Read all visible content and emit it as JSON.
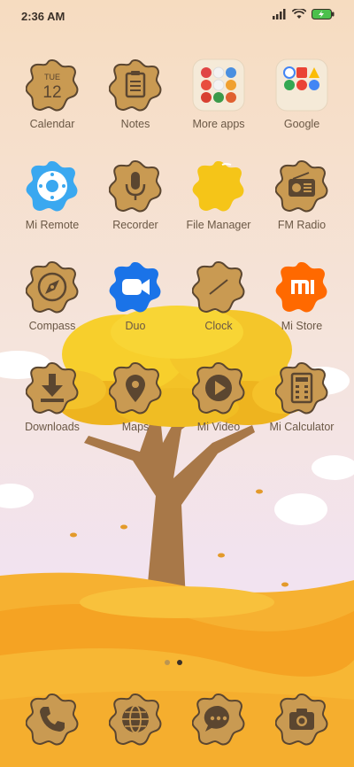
{
  "status_bar": {
    "time": "2:36 AM",
    "icons": [
      "signal-icon",
      "wifi-icon",
      "battery-charging-icon"
    ]
  },
  "calendar_badge": {
    "weekday": "TUE",
    "day": "12"
  },
  "apps": [
    {
      "label": "Calendar",
      "icon": "calendar-icon"
    },
    {
      "label": "Notes",
      "icon": "notes-icon"
    },
    {
      "label": "More apps",
      "icon": "folder-icon"
    },
    {
      "label": "Google",
      "icon": "folder-icon"
    },
    {
      "label": "Mi Remote",
      "icon": "remote-icon"
    },
    {
      "label": "Recorder",
      "icon": "microphone-icon"
    },
    {
      "label": "File Manager",
      "icon": "folder-icon"
    },
    {
      "label": "FM Radio",
      "icon": "radio-icon"
    },
    {
      "label": "Compass",
      "icon": "compass-icon"
    },
    {
      "label": "Duo",
      "icon": "video-camera-icon"
    },
    {
      "label": "Clock",
      "icon": "clock-icon"
    },
    {
      "label": "Mi Store",
      "icon": "mi-logo-icon"
    },
    {
      "label": "Downloads",
      "icon": "download-icon"
    },
    {
      "label": "Maps",
      "icon": "map-pin-icon"
    },
    {
      "label": "Mi Video",
      "icon": "play-icon"
    },
    {
      "label": "Mi Calculator",
      "icon": "calculator-icon"
    }
  ],
  "dock": [
    {
      "icon": "phone-icon"
    },
    {
      "icon": "browser-globe-icon"
    },
    {
      "icon": "messages-icon"
    },
    {
      "icon": "camera-icon"
    }
  ],
  "page_indicator": {
    "pages": 2,
    "active_index": 1
  },
  "colors": {
    "icon_fill": "#c99a52",
    "icon_stroke": "#5b4630",
    "label": "#6b5845",
    "sky_top": "#f6dfc5",
    "sky_bottom": "#f4e3ef",
    "ground": "#f5a823"
  }
}
